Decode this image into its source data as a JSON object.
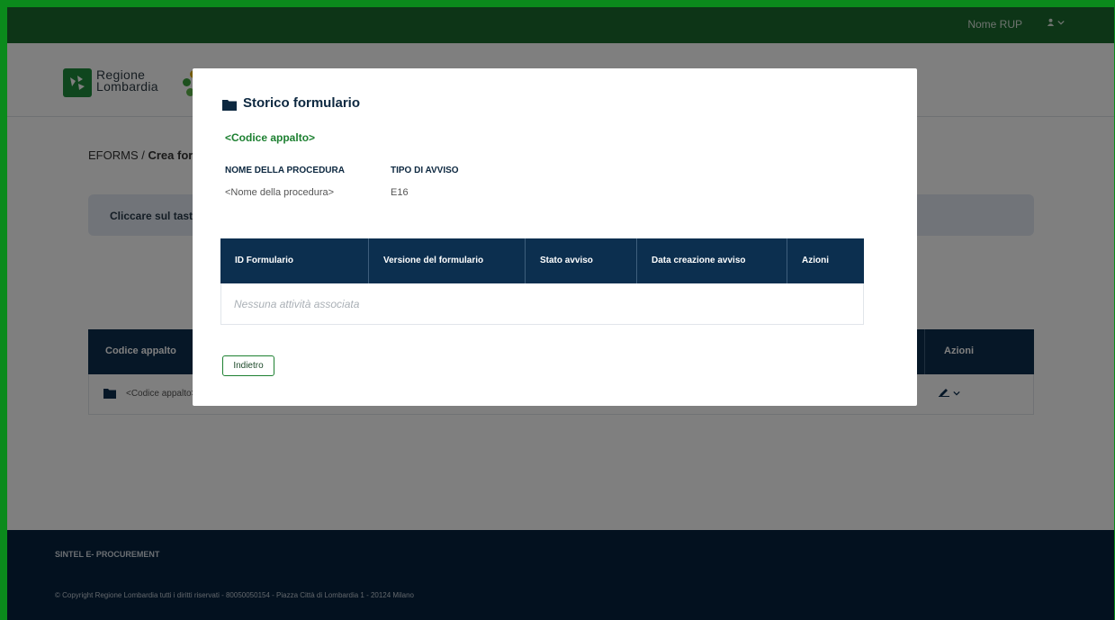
{
  "topbar": {
    "user_name": "Nome RUP",
    "user_menu_icon": "user-icon",
    "user_menu_caret": "chevron-down-icon"
  },
  "header": {
    "logo_line1": "Regione",
    "logo_line2": "Lombardia"
  },
  "breadcrumb": {
    "root": "EFORMS /",
    "current": "Crea form"
  },
  "info_box": {
    "text": "Cliccare sul tasto \""
  },
  "background_table": {
    "col_code": "Codice appalto",
    "col_actions": "Azioni",
    "row_code": "<Codice appalto>"
  },
  "footer": {
    "title": "SINTEL E- PROCUREMENT",
    "copyright": "© Copyright Regione Lombardia tutti i diritti riservati - 80050050154 - Piazza Città di Lombardia 1 - 20124 Milano"
  },
  "modal": {
    "title": "Storico formulario",
    "title_icon": "folder-icon",
    "code": "<Codice appalto>",
    "procedure_label": "NOME DELLA PROCEDURA",
    "procedure_value": "<Nome della procedura>",
    "notice_type_label": "TIPO DI AVVISO",
    "notice_type_value": "E16",
    "table": {
      "columns": [
        "ID Formulario",
        "Versione del formulario",
        "Stato avviso",
        "Data creazione avviso",
        "Azioni"
      ],
      "empty_text": "Nessuna attività associata"
    },
    "back_button": "Indietro"
  },
  "colors": {
    "topbar": "#1a6b2e",
    "accent_green": "#1d8031",
    "navy": "#0c2f4f",
    "footer": "#06233f"
  }
}
